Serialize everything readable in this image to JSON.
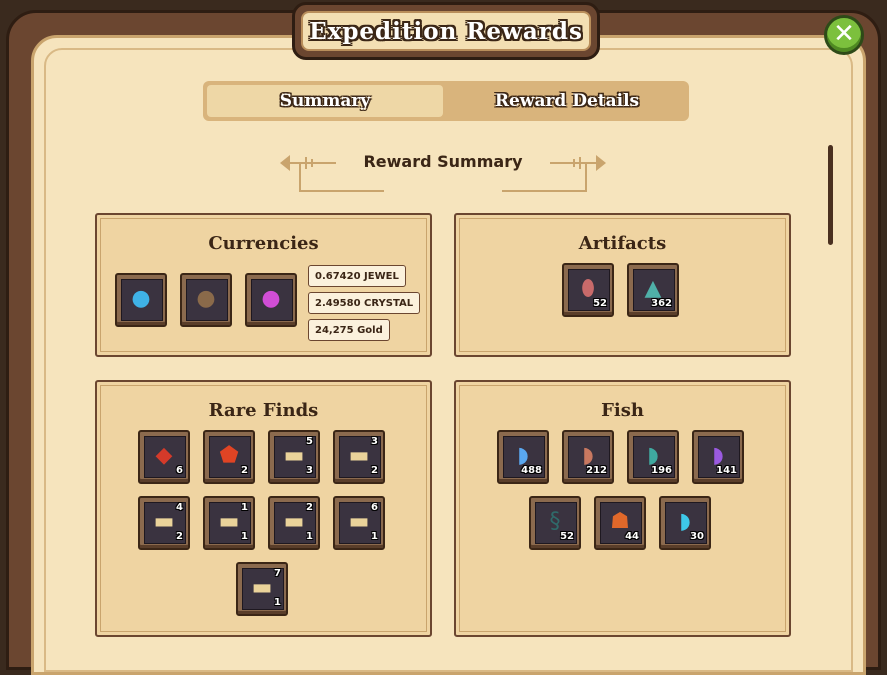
{
  "window": {
    "title": "Expedition Rewards",
    "close_icon": "close-icon"
  },
  "tabs": [
    {
      "label": "Summary",
      "active": true
    },
    {
      "label": "Reward Details",
      "active": false
    }
  ],
  "section_header": "Reward Summary",
  "panels": {
    "currencies": {
      "title": "Currencies",
      "items": [
        {
          "icon": "jewel-pouch-icon"
        },
        {
          "icon": "crystal-pouch-icon"
        },
        {
          "icon": "gold-pouch-icon"
        }
      ],
      "amounts": [
        "0.67420 JEWEL",
        "2.49580 CRYSTAL",
        "24,275 Gold"
      ]
    },
    "artifacts": {
      "title": "Artifacts",
      "items": [
        {
          "icon": "rune-stone-icon",
          "count": "52"
        },
        {
          "icon": "crystal-shard-icon",
          "count": "362"
        }
      ]
    },
    "rare_finds": {
      "title": "Rare Finds",
      "items": [
        {
          "icon": "red-ore-icon",
          "count": "6",
          "tier": ""
        },
        {
          "icon": "red-shield-icon",
          "count": "2",
          "tier": ""
        },
        {
          "icon": "scroll-icon",
          "count": "3",
          "tier": "5"
        },
        {
          "icon": "scroll-icon",
          "count": "2",
          "tier": "3"
        },
        {
          "icon": "scroll-icon",
          "count": "2",
          "tier": "4"
        },
        {
          "icon": "scroll-icon",
          "count": "1",
          "tier": "1"
        },
        {
          "icon": "scroll-icon",
          "count": "1",
          "tier": "2"
        },
        {
          "icon": "scroll-icon",
          "count": "1",
          "tier": "6"
        },
        {
          "icon": "scroll-icon",
          "count": "1",
          "tier": "7"
        }
      ]
    },
    "fish": {
      "title": "Fish",
      "items": [
        {
          "icon": "blue-fish-icon",
          "count": "488"
        },
        {
          "icon": "striped-fish-icon",
          "count": "212"
        },
        {
          "icon": "teal-fish-icon",
          "count": "196"
        },
        {
          "icon": "purple-fish-icon",
          "count": "141"
        },
        {
          "icon": "eel-icon",
          "count": "52"
        },
        {
          "icon": "crab-icon",
          "count": "44"
        },
        {
          "icon": "cyan-fish-icon",
          "count": "30"
        }
      ]
    }
  },
  "colors": {
    "frame": "#6b4630",
    "parchment": "#f6e4bd",
    "panel": "#efd4a2",
    "close_button": "#7cc03d"
  }
}
